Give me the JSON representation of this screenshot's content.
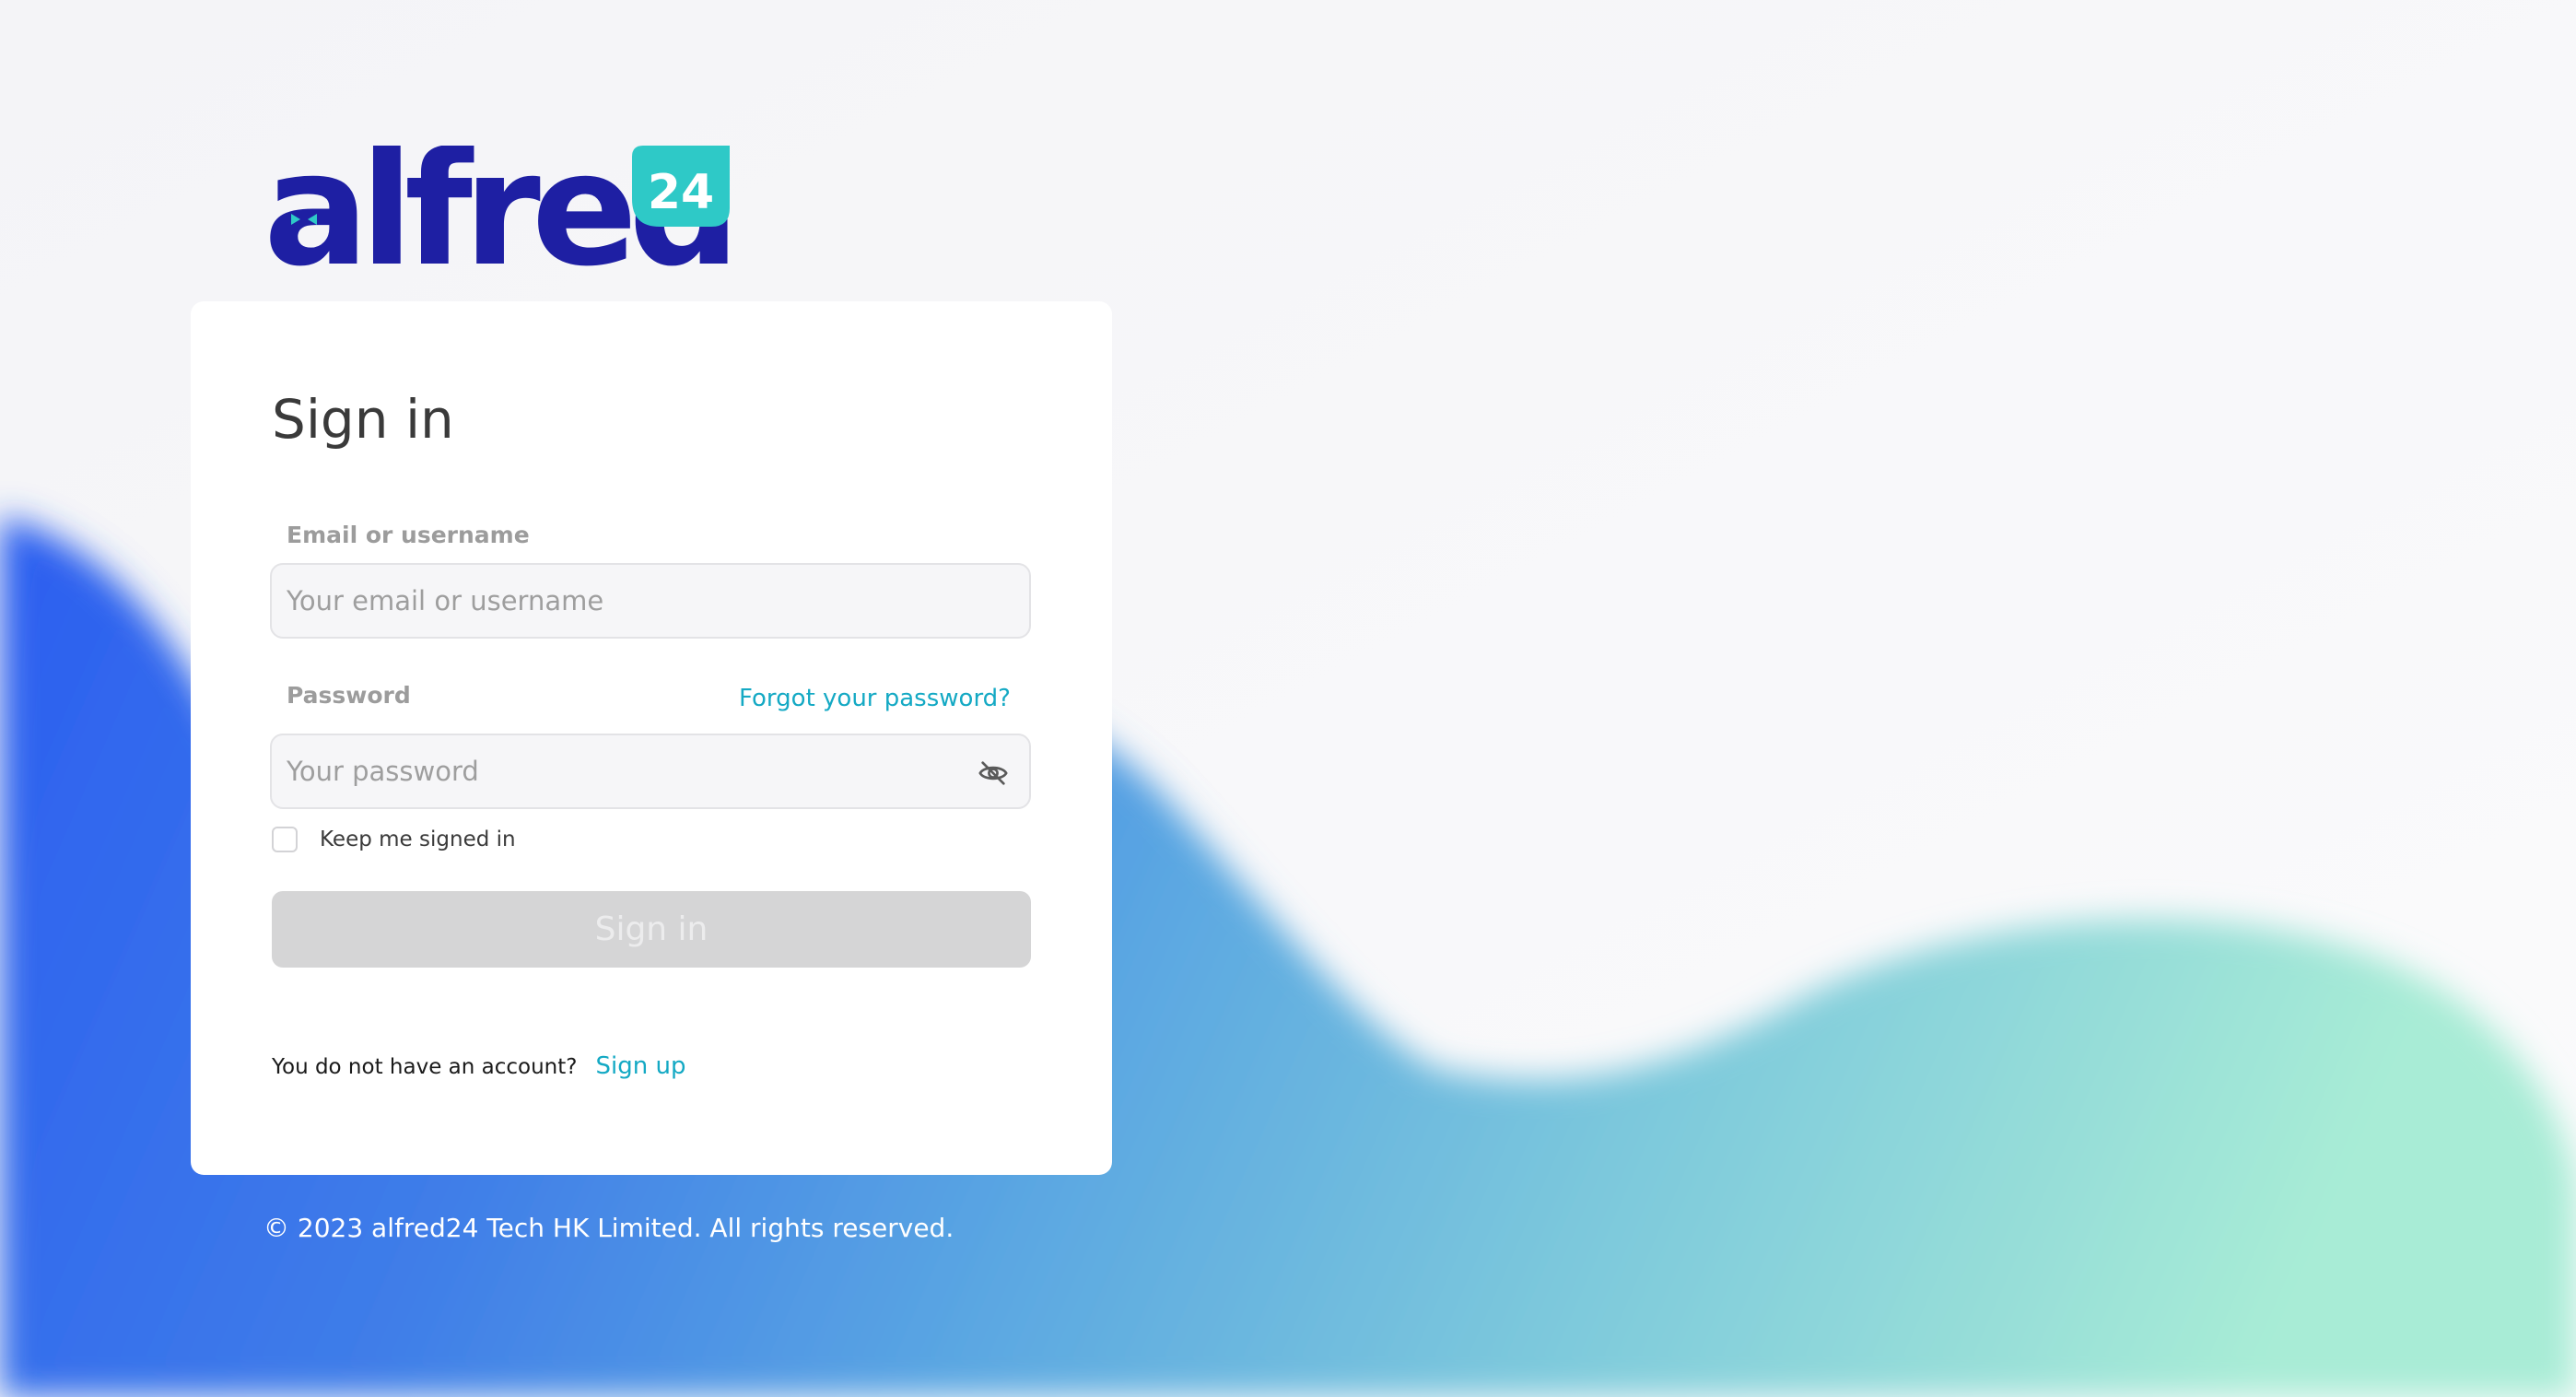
{
  "brand": {
    "logo_text": "alfred",
    "logo_badge": "24",
    "primary_color": "#1e1fa3",
    "accent_color": "#2ec9c7"
  },
  "signin": {
    "title": "Sign in",
    "email": {
      "label": "Email or username",
      "placeholder": "Your email or username",
      "value": ""
    },
    "password": {
      "label": "Password",
      "placeholder": "Your password",
      "value": "",
      "forgot_link": "Forgot your password?",
      "toggle_icon": "eye-off-icon"
    },
    "keep_signed_in": {
      "label": "Keep me signed in",
      "checked": false
    },
    "submit_label": "Sign in",
    "submit_disabled": true,
    "no_account_text": "You do not have an account?",
    "signup_link": "Sign up",
    "link_color": "#14a9c4"
  },
  "footer": {
    "copyright": "© 2023 alfred24 Tech HK Limited. All rights reserved."
  }
}
